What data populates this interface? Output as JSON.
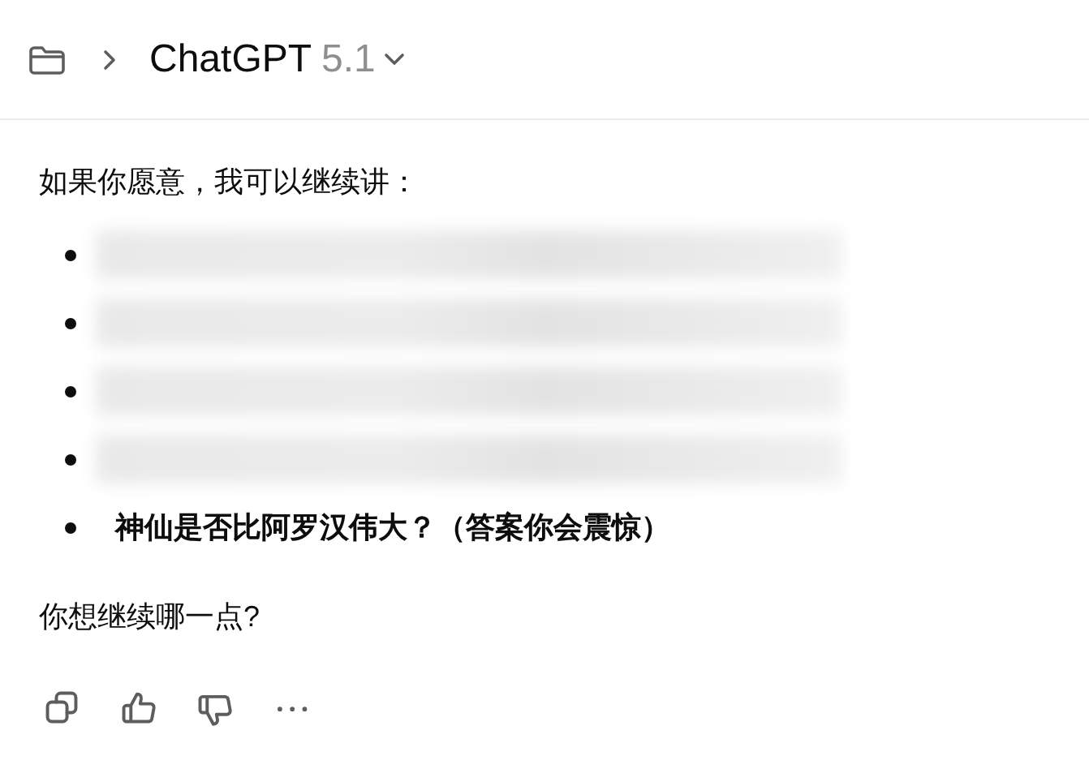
{
  "header": {
    "title": "ChatGPT",
    "version": "5.1"
  },
  "message": {
    "intro": "如果你愿意，我可以继续讲：",
    "items": [
      {
        "kind": "redacted"
      },
      {
        "kind": "redacted"
      },
      {
        "kind": "redacted"
      },
      {
        "kind": "redacted"
      },
      {
        "kind": "text",
        "text": "神仙是否比阿罗汉伟大？（答案你会震惊）"
      }
    ],
    "question": "你想继续哪一点?"
  },
  "actions": [
    {
      "kind": "copy"
    },
    {
      "kind": "like"
    },
    {
      "kind": "dislike"
    },
    {
      "kind": "more"
    }
  ]
}
